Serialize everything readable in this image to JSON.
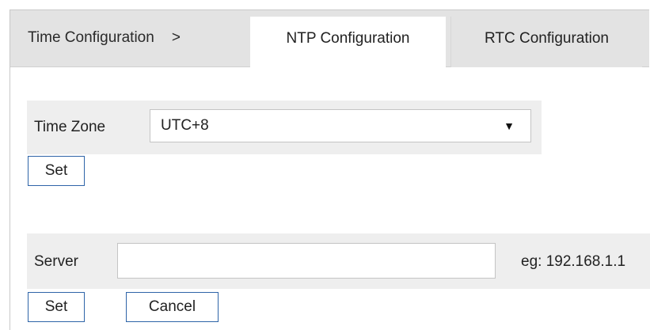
{
  "tabs": {
    "breadcrumb": "Time Configuration",
    "separator": ">",
    "ntp": "NTP Configuration",
    "rtc": "RTC Configuration"
  },
  "timezone": {
    "label": "Time Zone",
    "value": "UTC+8",
    "arrow": "▼",
    "set_label": "Set"
  },
  "server": {
    "label": "Server",
    "value": "",
    "hint": "eg: 192.168.1.1",
    "set_label": "Set",
    "cancel_label": "Cancel"
  },
  "colors": {
    "tabbar_bg": "#e3e3e3",
    "row_bg": "#eeeeee",
    "button_border": "#2e64a8"
  }
}
